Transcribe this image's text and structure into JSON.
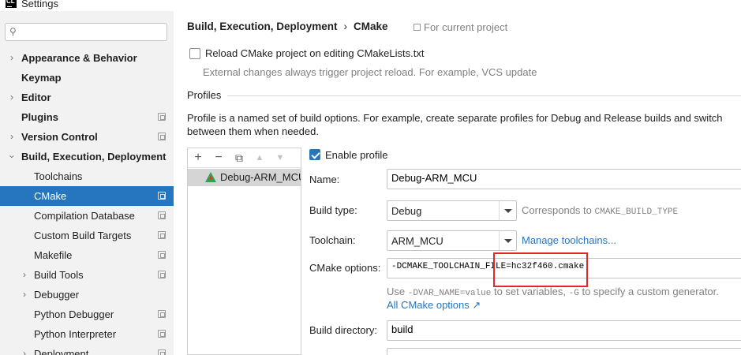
{
  "window": {
    "title": "Settings",
    "icon_text": "CL"
  },
  "sidebar": {
    "search_placeholder": "",
    "items": [
      {
        "label": "Appearance & Behavior"
      },
      {
        "label": "Keymap"
      },
      {
        "label": "Editor"
      },
      {
        "label": "Plugins"
      },
      {
        "label": "Version Control"
      },
      {
        "label": "Build, Execution, Deployment"
      },
      {
        "label": "Toolchains"
      },
      {
        "label": "CMake"
      },
      {
        "label": "Compilation Database"
      },
      {
        "label": "Custom Build Targets"
      },
      {
        "label": "Makefile"
      },
      {
        "label": "Build Tools"
      },
      {
        "label": "Debugger"
      },
      {
        "label": "Python Debugger"
      },
      {
        "label": "Python Interpreter"
      },
      {
        "label": "Deployment"
      }
    ]
  },
  "header": {
    "breadcrumb_parent": "Build, Execution, Deployment",
    "breadcrumb_sep": "›",
    "breadcrumb_current": "CMake",
    "for_current_project": "For current project"
  },
  "reload": {
    "label": "Reload CMake project on editing CMakeLists.txt",
    "checked": false,
    "hint": "External changes always trigger project reload. For example, VCS update"
  },
  "profiles": {
    "section_title": "Profiles",
    "description_line1": "Profile is a named set of build options. For example, create separate profiles for Debug and Release builds and switch",
    "description_line2": "between them when needed.",
    "list": [
      {
        "label": "Debug-ARM_MCU"
      }
    ],
    "toolbar": {
      "add": "+",
      "remove": "−",
      "copy": "⧉",
      "up": "▲",
      "down": "▼"
    }
  },
  "form": {
    "enable_profile_label": "Enable profile",
    "enable_profile_checked": true,
    "name_label": "Name:",
    "name_value": "Debug-ARM_MCU",
    "build_type_label": "Build type:",
    "build_type_value": "Debug",
    "build_type_hint_prefix": "Corresponds to ",
    "build_type_hint_code": "CMAKE_BUILD_TYPE",
    "toolchain_label": "Toolchain:",
    "toolchain_value": "ARM_MCU",
    "manage_toolchains": "Manage toolchains...",
    "cmake_options_label": "CMake options:",
    "cmake_options_value": "-DCMAKE_TOOLCHAIN_FILE=hc32f460.cmake",
    "cmake_hint_use": "Use ",
    "cmake_hint_code1": "-DVAR_NAME=value",
    "cmake_hint_mid": " to set variables, ",
    "cmake_hint_code2": "-G",
    "cmake_hint_end": " to specify a custom generator.",
    "all_cmake_options": "All CMake options ↗",
    "build_dir_label": "Build directory:",
    "build_dir_value": "build"
  },
  "colors": {
    "accent": "#2675bf",
    "highlight_box": "#e0282e",
    "sidebar_bg": "#f2f2f2"
  }
}
